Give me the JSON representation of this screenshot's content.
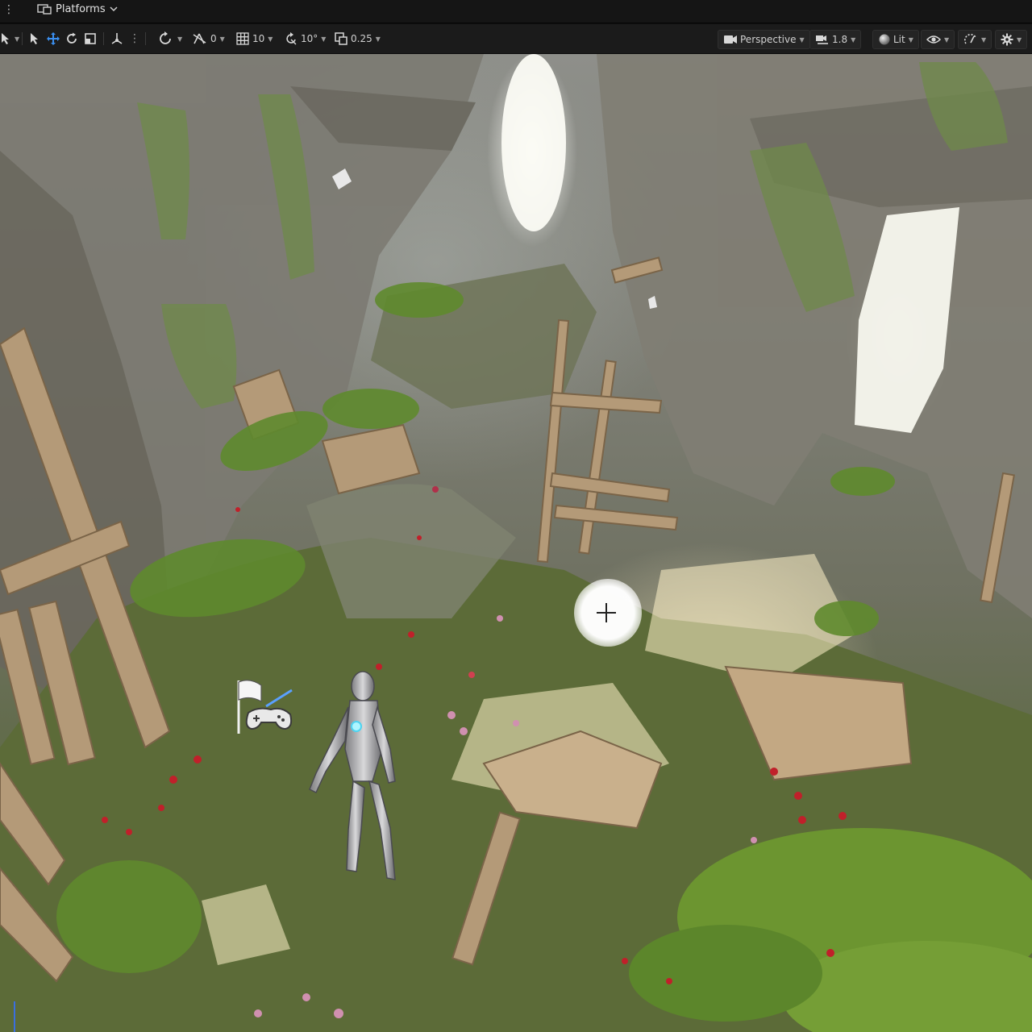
{
  "menu_bar": {
    "platforms_label": "Platforms"
  },
  "toolbar": {
    "translate_snap_value": "0",
    "grid_snap_value": "10",
    "rotation_snap_value": "10°",
    "scale_snap_value": "0.25",
    "view_mode_label": "Perspective",
    "camera_speed_value": "1.8",
    "lighting_mode_label": "Lit"
  },
  "colors": {
    "toolbar_bg": "#1b1b1b",
    "menu_bg": "#151515",
    "accent_blue": "#3a8ff0"
  },
  "icons": {
    "menu": "kebab-icon",
    "platforms": "platforms-icon",
    "select": "cursor-icon",
    "translate": "move-arrows-icon",
    "rotate": "rotate-icon",
    "scale": "scale-icon",
    "coordinate_space": "coordinate-icon",
    "surface_snap": "surface-snap-icon",
    "translate_snap": "snap-icon",
    "grid": "grid-icon",
    "rotation_snap": "rotation-snap-icon",
    "scale_snap": "scale-snap-icon",
    "perspective": "camera-icon",
    "camera_speed": "camera-speed-icon",
    "lit": "lit-sphere-icon",
    "show": "eye-icon",
    "realtime": "realtime-icon",
    "settings": "gear-icon"
  }
}
